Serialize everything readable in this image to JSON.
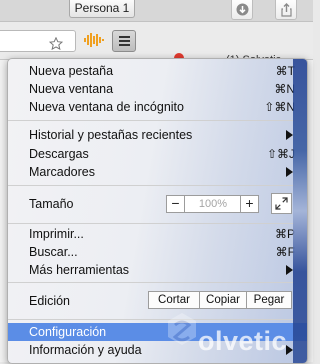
{
  "chrome": {
    "profile_label": "Persona 1",
    "tab_title": "(1) Solvetic"
  },
  "menu": {
    "new_tab": {
      "label": "Nueva pestaña",
      "shortcut": "⌘T"
    },
    "new_window": {
      "label": "Nueva ventana",
      "shortcut": "⌘N"
    },
    "new_incognito": {
      "label": "Nueva ventana de incógnito",
      "shortcut": "⇧⌘N"
    },
    "history": {
      "label": "Historial y pestañas recientes"
    },
    "downloads": {
      "label": "Descargas",
      "shortcut": "⇧⌘J"
    },
    "bookmarks": {
      "label": "Marcadores"
    },
    "zoom": {
      "label": "Tamaño",
      "minus": "−",
      "value": "100%",
      "plus": "+"
    },
    "print": {
      "label": "Imprimir...",
      "shortcut": "⌘P"
    },
    "find": {
      "label": "Buscar...",
      "shortcut": "⌘F"
    },
    "more_tools": {
      "label": "Más herramientas"
    },
    "edit": {
      "label": "Edición",
      "cut": "Cortar",
      "copy": "Copiar",
      "paste": "Pegar"
    },
    "settings": {
      "label": "Configuración"
    },
    "help": {
      "label": "Información y ayuda"
    }
  },
  "watermark": "olvetic",
  "colors": {
    "highlight": "#5b8de6",
    "menu_bg": "#f2f2f4",
    "accent_sound": "#f0a020"
  }
}
